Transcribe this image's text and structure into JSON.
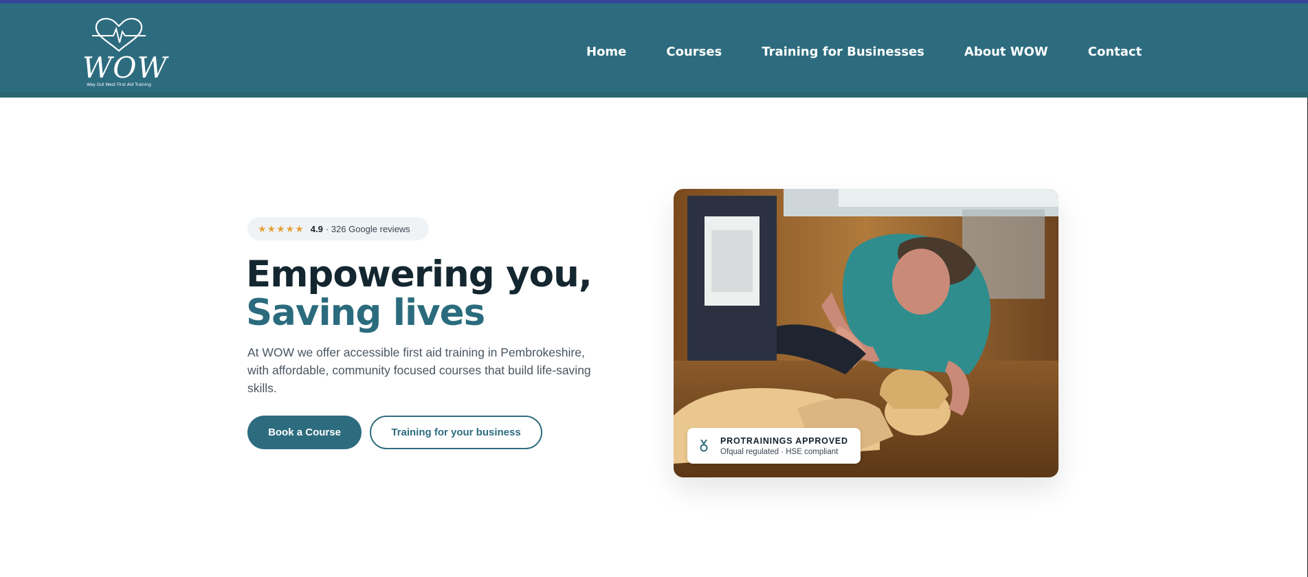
{
  "brand": {
    "logo_text": "WOW",
    "tagline": "Way Out West First Aid Training"
  },
  "nav": {
    "items": [
      {
        "label": "Home"
      },
      {
        "label": "Courses"
      },
      {
        "label": "Training for Businesses"
      },
      {
        "label": "About WOW"
      },
      {
        "label": "Contact"
      }
    ]
  },
  "hero": {
    "rating": {
      "stars": "★★★★★",
      "score": "4.9",
      "reviews": "· 326 Google reviews"
    },
    "headline_line1": "Empowering you,",
    "headline_line2": "Saving lives",
    "intro": "At WOW we offer accessible first aid training in Pembrokeshire, with affordable, community focused courses that build life-saving skills.",
    "primary_button": "Book a Course",
    "secondary_button": "Training for your business"
  },
  "photo": {
    "badge_title": "PROTRAININGS APPROVED",
    "badge_subtitle": "Ofqual regulated · HSE compliant",
    "badge_icon": "medal-icon"
  },
  "colors": {
    "header": "#2d6c7f",
    "accent": "#2b6b7e",
    "star": "#e6a13a",
    "top_strip": "#35459a"
  }
}
